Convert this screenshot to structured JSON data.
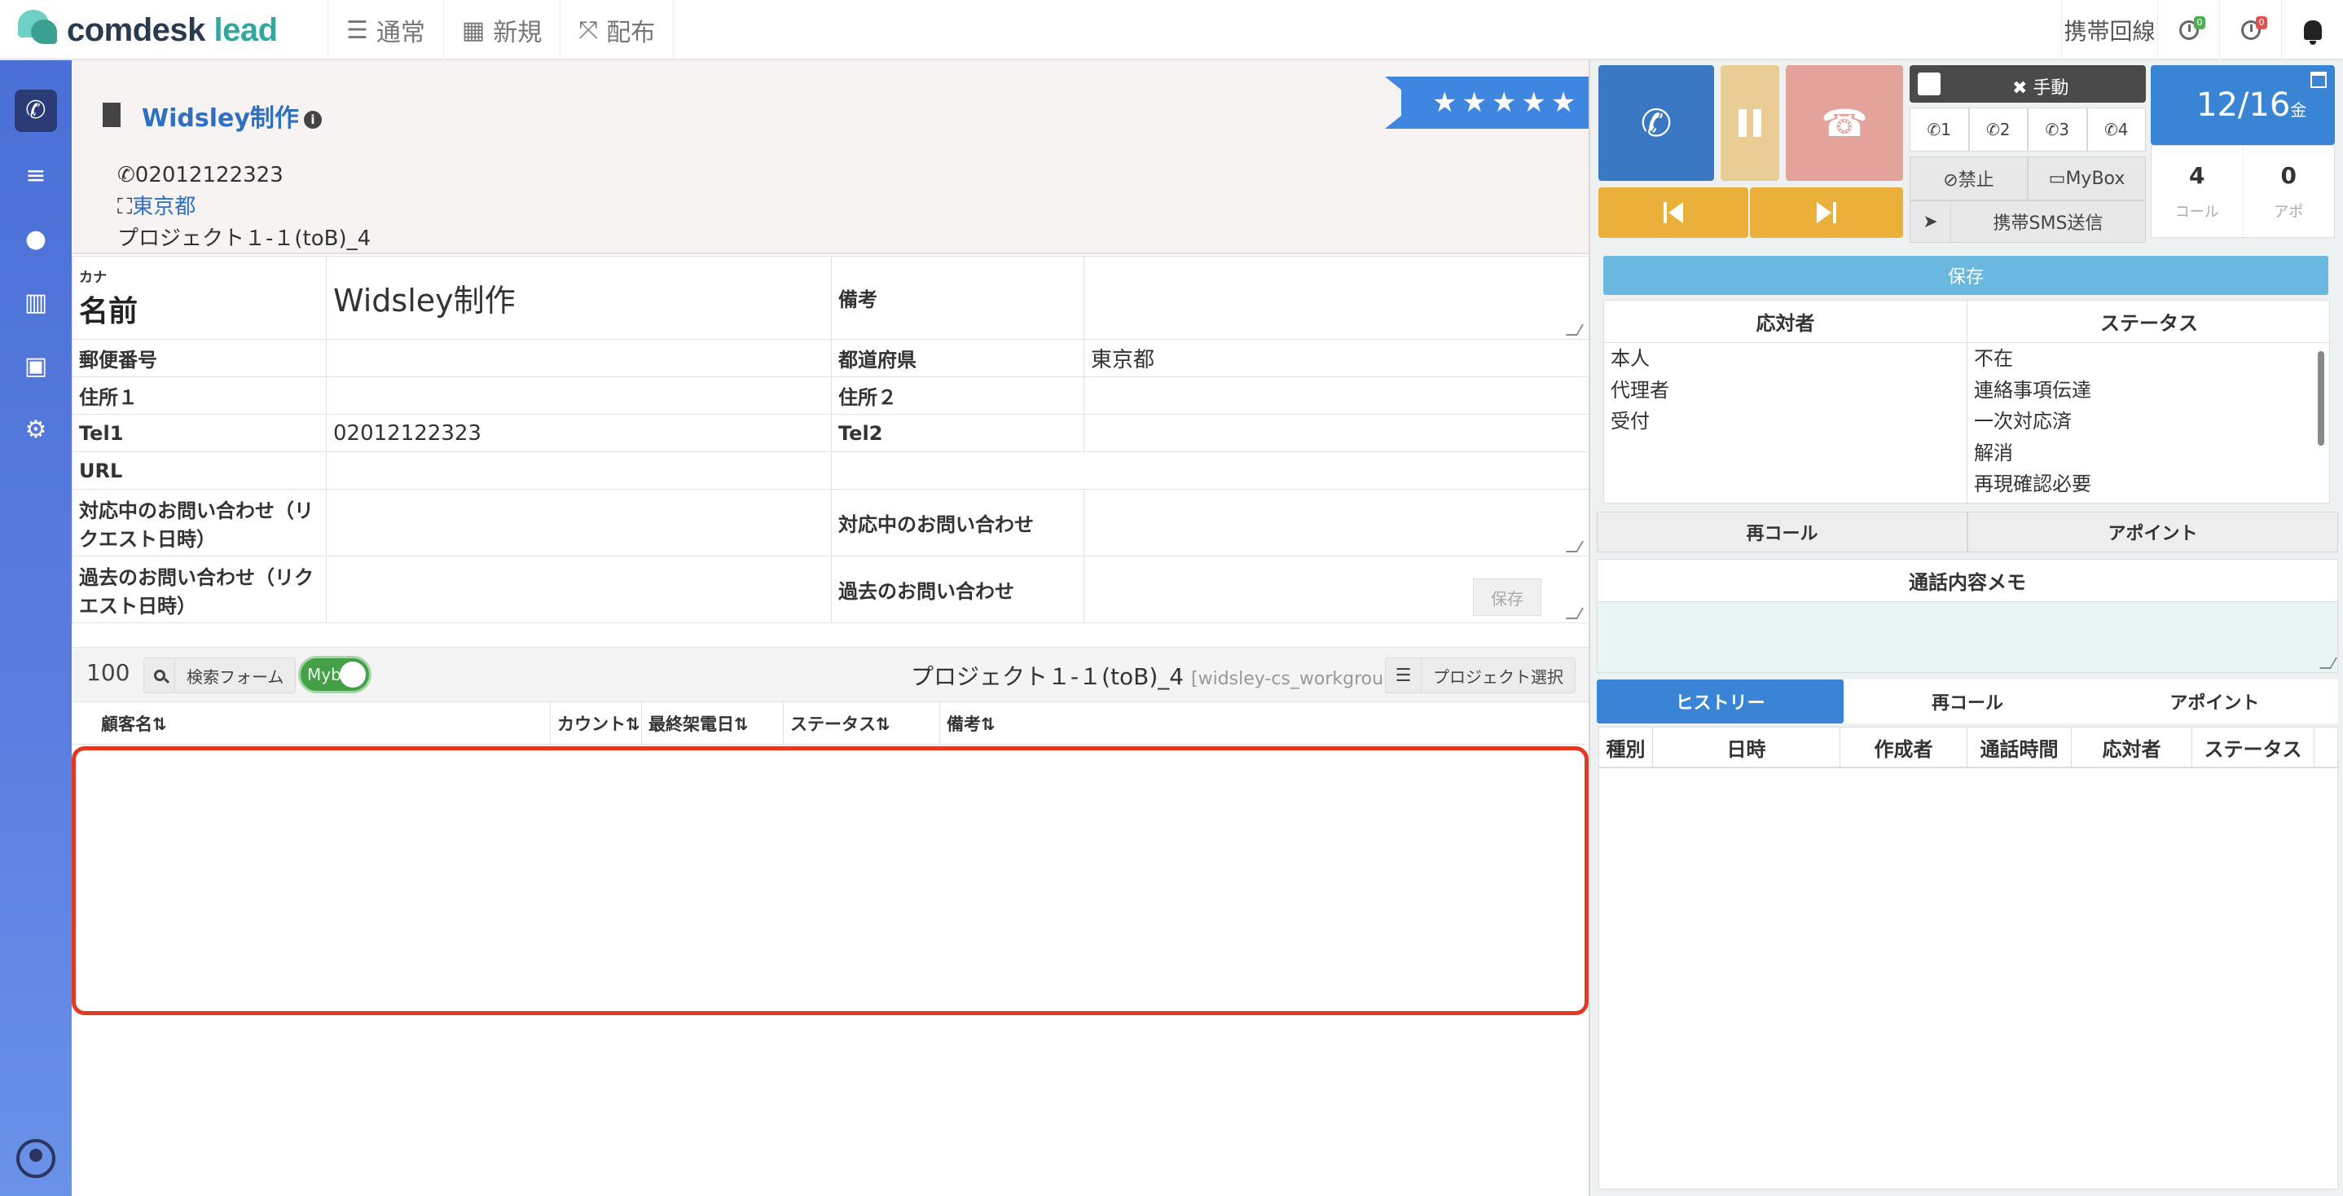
{
  "app": {
    "brand_main": "comdesk",
    "brand_accent": "lead"
  },
  "topnav": {
    "items": [
      {
        "icon": "list-icon",
        "label": "通常"
      },
      {
        "icon": "grid-icon",
        "label": "新規"
      },
      {
        "icon": "expand-icon",
        "label": "配布"
      }
    ]
  },
  "topright": {
    "mobile_line": "携帯回線",
    "badge_green": "0",
    "badge_red": "0"
  },
  "sidebar": {
    "items": [
      "phone-icon",
      "database-icon",
      "users-icon",
      "chart-icon",
      "board-icon",
      "gear-icon",
      "account-icon"
    ]
  },
  "company": {
    "name": "Widsley制作",
    "rating_stars": "★★★★★",
    "rating": 5,
    "phone": "02012122323",
    "location": "東京都",
    "project": "プロジェクト１-１(toB)_4"
  },
  "form": {
    "kana_label": "カナ",
    "name_label": "名前",
    "name_value": "Widsley制作",
    "note_label": "備考",
    "postal_label": "郵便番号",
    "pref_label": "都道府県",
    "pref_value": "東京都",
    "addr1_label": "住所１",
    "addr2_label": "住所２",
    "tel1_label": "Tel1",
    "tel1_value": "02012122323",
    "tel2_label": "Tel2",
    "url_label": "URL",
    "cur_inq_date_label": "対応中のお問い合わせ（リクエスト日時）",
    "cur_inq_label": "対応中のお問い合わせ",
    "past_inq_date_label": "過去のお問い合わせ（リクエスト日時）",
    "past_inq_label": "過去のお問い合わせ",
    "save_label": "保存"
  },
  "listbar": {
    "count": "100",
    "search_label": "検索フォーム",
    "toggle_label": "Mybo",
    "project_title": "プロジェクト１-１(toB)_4",
    "workgroup": "[widsley-cs_workgroup]",
    "project_select": "プロジェクト選択"
  },
  "list": {
    "columns": [
      "顧客名⇅",
      "カウント⇅",
      "最終架電日⇅",
      "ステータス⇅",
      "備考⇅"
    ],
    "rows": []
  },
  "phone_panel": {
    "manual_label": "✖ 手動",
    "lines": [
      "1",
      "2",
      "3",
      "4"
    ],
    "ban_label": "⊘禁止",
    "mybox_label": "MyBox",
    "sms_label": "携帯SMS送信",
    "date": "12/16",
    "weekday": "金",
    "calls_count": "4",
    "calls_unit": "コール",
    "appo_count": "0",
    "appo_unit": "アポ"
  },
  "result": {
    "save_label": "保存",
    "responder_header": "応対者",
    "responders": [
      "本人",
      "代理者",
      "受付"
    ],
    "status_header": "ステータス",
    "statuses": [
      "不在",
      "連絡事項伝達",
      "一次対応済",
      "解消",
      "再現確認必要"
    ],
    "recall_label": "再コール",
    "appoint_label": "アポイント",
    "memo_header": "通話内容メモ"
  },
  "history": {
    "tabs": [
      "ヒストリー",
      "再コール",
      "アポイント"
    ],
    "columns": [
      "種別",
      "日時",
      "作成者",
      "通話時間",
      "応対者",
      "ステータス"
    ]
  },
  "colors": {
    "sidebar": "#5b7fe0",
    "call_button": "#3a78c4",
    "hangup_button": "#e3a39b",
    "nav_buttons": "#ebb039",
    "highlight_border": "#e23a22"
  }
}
